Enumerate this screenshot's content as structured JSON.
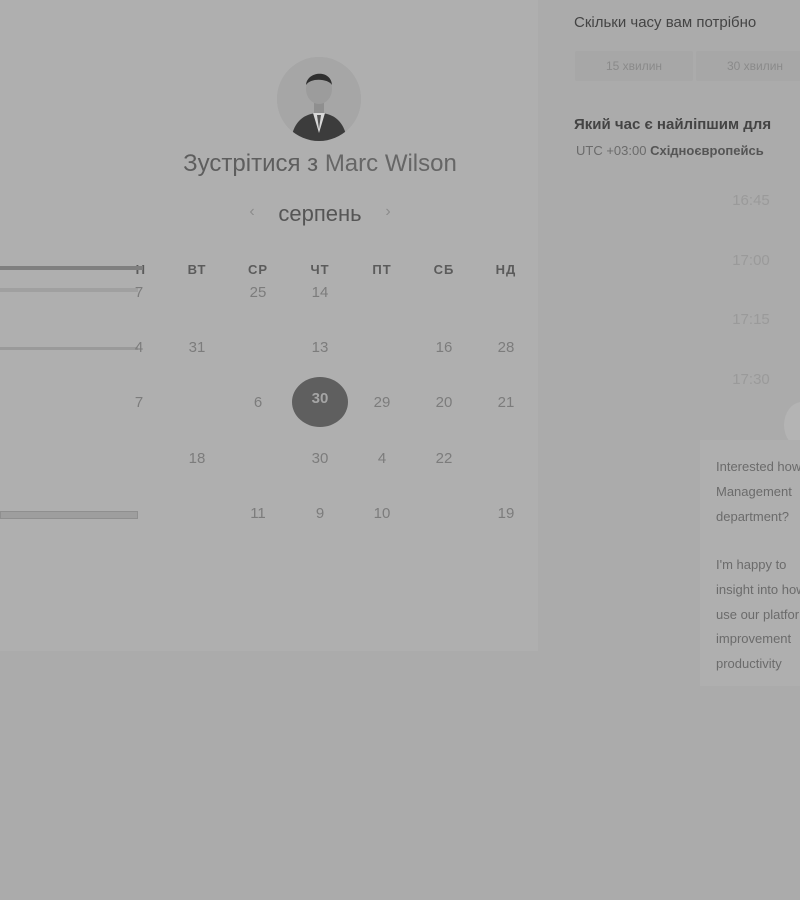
{
  "host": {
    "prefix": "Зустрітися з",
    "name": "Marc Wilson"
  },
  "calendar": {
    "month": "серпень",
    "prev_icon": "‹",
    "next_icon": "›",
    "weekdays_visible": [
      "ВТ",
      "СР",
      "ЧТ",
      "ПТ",
      "СБ",
      "НД"
    ],
    "weekday_partial": "Н",
    "rows": [
      [
        "7",
        "",
        "25",
        "14",
        "",
        "",
        ""
      ],
      [
        "4",
        "31",
        "",
        "13",
        "",
        "16",
        "28"
      ],
      [
        "7",
        "",
        "6",
        "30",
        "29",
        "20",
        "21"
      ],
      [
        "",
        "18",
        "",
        "30",
        "4",
        "22",
        ""
      ],
      [
        "",
        "",
        "11",
        "9",
        "10",
        "",
        "19"
      ]
    ],
    "selected_day": "30"
  },
  "duration": {
    "question": "Скільки часу вам потрібно",
    "options": [
      "15 хвилин",
      "30 хвилин"
    ]
  },
  "time": {
    "question": "Який час є найліпшим для",
    "timezone_offset": "UTC +03:00",
    "timezone_name": "Східноєвропейсь",
    "slots": [
      "16:45",
      "17:00",
      "17:15",
      "17:30"
    ]
  },
  "bio": {
    "lines": [
      "Interested how",
      "Management",
      "department?",
      "",
      "I'm happy to",
      "insight into how",
      "use our platform",
      "improvement",
      "productivity"
    ]
  },
  "colors": {
    "overlay_background": "#ababab",
    "selected_day": "#5f5f5f"
  }
}
